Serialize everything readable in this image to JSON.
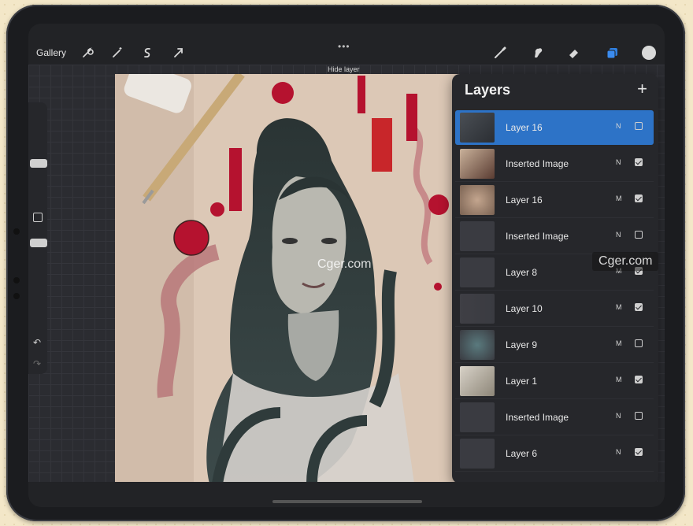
{
  "toolbar": {
    "gallery_label": "Gallery",
    "more_dots": "•••",
    "hide_layer_hint": "Hide layer",
    "icons": [
      "wrench-icon",
      "magic-wand-icon",
      "selection-icon",
      "transform-arrow-icon",
      "brush-icon",
      "smudge-icon",
      "eraser-icon",
      "layers-icon"
    ],
    "current_color": "#d9d9d9",
    "accent": "#2d73c7"
  },
  "sidebar": {
    "undo": "↶",
    "redo": "↷"
  },
  "layers": {
    "title": "Layers",
    "add_symbol": "+",
    "items": [
      {
        "name": "Layer 16",
        "mode": "N",
        "visible": false,
        "selected": true
      },
      {
        "name": "Inserted Image",
        "mode": "N",
        "visible": true,
        "selected": false
      },
      {
        "name": "Layer 16",
        "mode": "M",
        "visible": true,
        "selected": false
      },
      {
        "name": "Inserted Image",
        "mode": "N",
        "visible": false,
        "selected": false
      },
      {
        "name": "Layer 8",
        "mode": "M",
        "visible": true,
        "selected": false
      },
      {
        "name": "Layer 10",
        "mode": "M",
        "visible": true,
        "selected": false
      },
      {
        "name": "Layer 9",
        "mode": "M",
        "visible": false,
        "selected": false
      },
      {
        "name": "Layer 1",
        "mode": "M",
        "visible": true,
        "selected": false
      },
      {
        "name": "Inserted Image",
        "mode": "N",
        "visible": false,
        "selected": false
      },
      {
        "name": "Layer 6",
        "mode": "N",
        "visible": true,
        "selected": false
      }
    ]
  },
  "watermarks": [
    "Cger.com",
    "Cger.com"
  ]
}
